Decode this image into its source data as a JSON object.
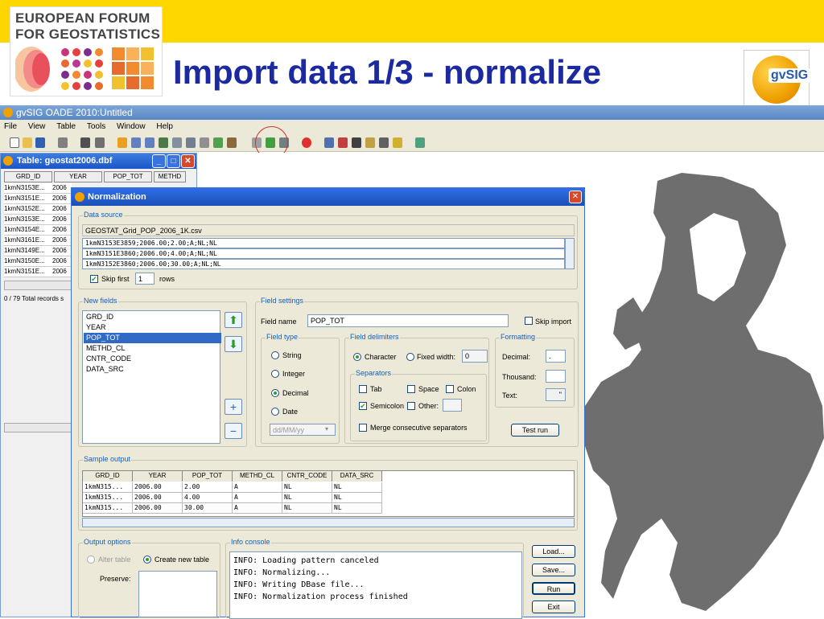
{
  "slide": {
    "logo_text": "EUROPEAN FORUM\nFOR GEOSTATISTICS",
    "title": "Import data 1/3 - normalize",
    "gvsig_logo_text": "gvSIG"
  },
  "app": {
    "title": "gvSIG OADE 2010:Untitled",
    "menu": [
      "File",
      "View",
      "Table",
      "Tools",
      "Window",
      "Help"
    ]
  },
  "table_window": {
    "title": "Table: geostat2006.dbf",
    "columns": [
      "GRD_ID",
      "YEAR",
      "POP_TOT",
      "METHD"
    ],
    "rows": [
      [
        "1kmN3153E...",
        "2006"
      ],
      [
        "1kmN3151E...",
        "2006"
      ],
      [
        "1kmN3152E...",
        "2006"
      ],
      [
        "1kmN3153E...",
        "2006"
      ],
      [
        "1kmN3154E...",
        "2006"
      ],
      [
        "1kmN3161E...",
        "2006"
      ],
      [
        "1kmN3149E...",
        "2006"
      ],
      [
        "1kmN3150E...",
        "2006"
      ],
      [
        "1kmN3151E...",
        "2006"
      ]
    ],
    "status": "0 / 79 Total records s"
  },
  "normalization": {
    "title": "Normalization",
    "data_source": {
      "label": "Data source",
      "file_name": "GEOSTAT_Grid_POP_2006_1K.csv",
      "lines": [
        "1kmN3153E3859;2006.00;2.00;A;NL;NL",
        "1kmN3151E3860;2006.00;4.00;A;NL;NL",
        "1kmN3152E3860;2006.00;30.00;A;NL;NL"
      ],
      "skip_first_label": "Skip first",
      "skip_first_value": "1",
      "rows_label": "rows"
    },
    "new_fields": {
      "label": "New fields",
      "items": [
        "GRD_ID",
        "YEAR",
        "POP_TOT",
        "METHD_CL",
        "CNTR_CODE",
        "DATA_SRC"
      ],
      "selected": "POP_TOT"
    },
    "field_settings": {
      "label": "Field settings",
      "field_name_label": "Field name",
      "field_name_value": "POP_TOT",
      "skip_import_label": "Skip import",
      "field_type": {
        "label": "Field type",
        "options": [
          "String",
          "Integer",
          "Decimal",
          "Date"
        ],
        "selected": "Decimal",
        "date_format": "dd/MM/yy"
      },
      "field_delimiters": {
        "label": "Field delimiters",
        "character_label": "Character",
        "fixed_width_label": "Fixed width:",
        "fixed_width_value": "0",
        "separators_label": "Separators",
        "tab_label": "Tab",
        "space_label": "Space",
        "colon_label": "Colon",
        "semicolon_label": "Semicolon",
        "other_label": "Other:",
        "merge_label": "Merge consecutive separators"
      },
      "formatting": {
        "label": "Formatting",
        "decimal_label": "Decimal:",
        "decimal_value": ".",
        "thousand_label": "Thousand:",
        "thousand_value": "",
        "text_label": "Text:",
        "text_value": "\""
      },
      "test_run_label": "Test run"
    },
    "sample_output": {
      "label": "Sample output",
      "columns": [
        "GRD_ID",
        "YEAR",
        "POP_TOT",
        "METHD_CL",
        "CNTR_CODE",
        "DATA_SRC"
      ],
      "rows": [
        [
          "1kmN315...",
          "2006.00",
          "2.00",
          "A",
          "NL",
          "NL"
        ],
        [
          "1kmN315...",
          "2006.00",
          "4.00",
          "A",
          "NL",
          "NL"
        ],
        [
          "1kmN315...",
          "2006.00",
          "30.00",
          "A",
          "NL",
          "NL"
        ]
      ]
    },
    "output_options": {
      "label": "Output options",
      "alter_table_label": "Alter table",
      "create_new_table_label": "Create new table",
      "preserve_label": "Preserve:"
    },
    "info_console": {
      "label": "Info console",
      "lines": [
        "INFO: Loading pattern canceled",
        "INFO: Normalizing...",
        "INFO: Writing DBase file...",
        "INFO: Normalization process finished"
      ]
    },
    "buttons": {
      "load": "Load...",
      "save": "Save...",
      "run": "Run",
      "exit": "Exit"
    }
  }
}
